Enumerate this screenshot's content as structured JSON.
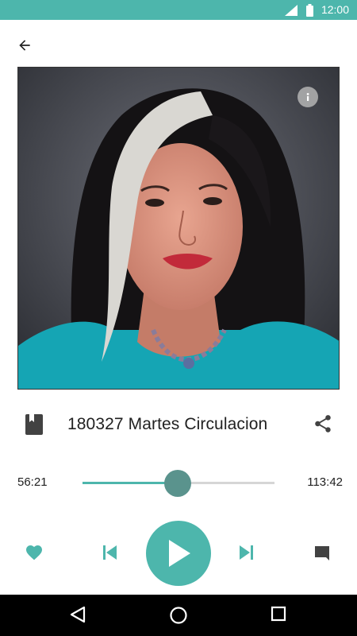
{
  "status_bar": {
    "time": "12:00",
    "color": "#4db6ac"
  },
  "header": {
    "back_icon": "arrow-left-icon"
  },
  "artwork": {
    "info_icon": "info-icon"
  },
  "track": {
    "title": "180327 Martes Circulacion",
    "book_icon": "book-icon",
    "share_icon": "share-icon"
  },
  "progress": {
    "elapsed": "56:21",
    "total": "113:42",
    "fraction": 0.4955
  },
  "controls": {
    "favorite_icon": "heart-icon",
    "previous_icon": "skip-previous-icon",
    "play_icon": "play-icon",
    "next_icon": "skip-next-icon",
    "comment_icon": "comment-icon",
    "accent": "#4db6ac"
  },
  "system_nav": {
    "back": "triangle-back-icon",
    "home": "circle-home-icon",
    "recents": "square-recents-icon"
  }
}
